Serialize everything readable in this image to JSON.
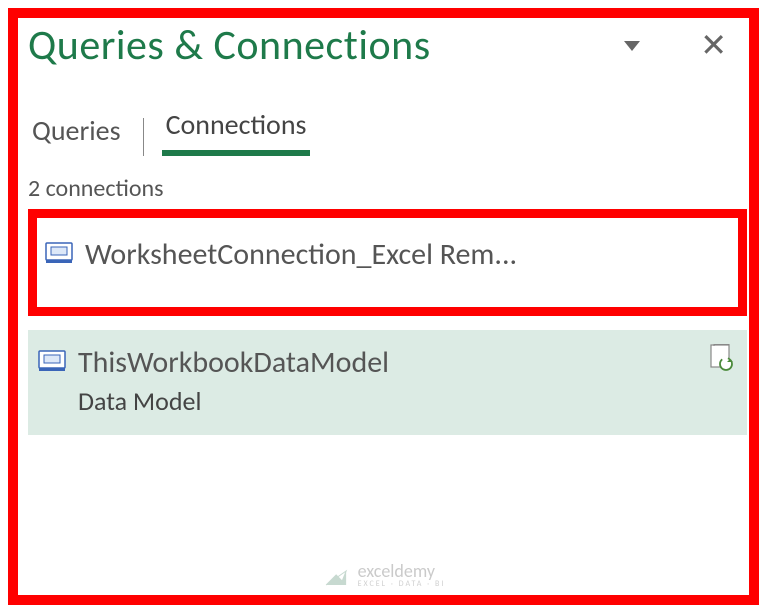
{
  "panel": {
    "title": "Queries & Connections"
  },
  "tabs": [
    {
      "label": "Queries",
      "active": false
    },
    {
      "label": "Connections",
      "active": true
    }
  ],
  "connections": {
    "count_text": "2 connections",
    "items": [
      {
        "name": "WorksheetConnection_Excel Rem...",
        "subtitle": ""
      },
      {
        "name": "ThisWorkbookDataModel",
        "subtitle": "Data Model"
      }
    ]
  },
  "watermark": {
    "name": "exceldemy",
    "tagline": "EXCEL · DATA · BI"
  }
}
